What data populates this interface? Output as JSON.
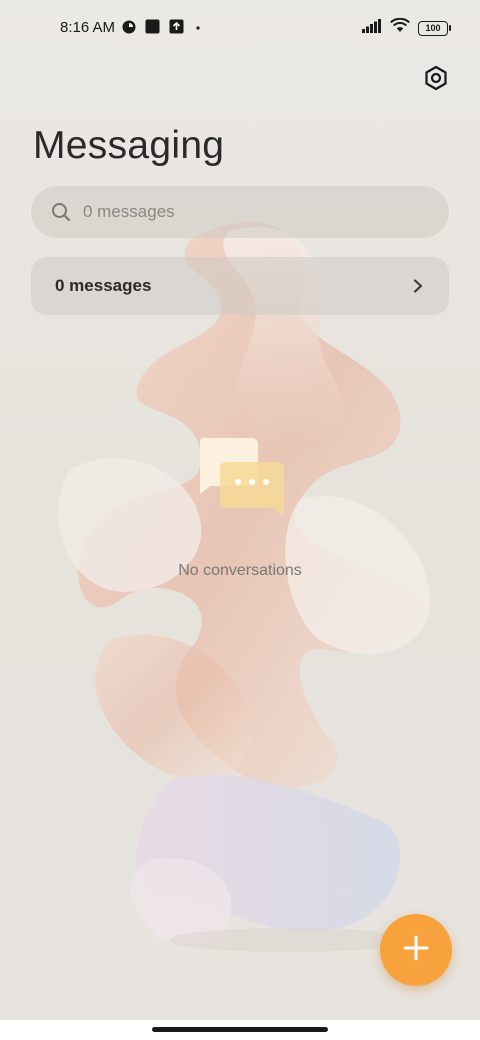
{
  "status_bar": {
    "time": "8:16 AM",
    "battery": "100",
    "icons": [
      "app-status-icon",
      "square-notification-icon",
      "upload-notification-icon",
      "dot-icon",
      "signal-icon",
      "wifi-icon",
      "battery-icon"
    ]
  },
  "header": {
    "title": "Messaging",
    "settings_icon": "settings-icon"
  },
  "search": {
    "placeholder": "0 messages"
  },
  "messages_row": {
    "label": "0 messages"
  },
  "empty_state": {
    "text": "No conversations"
  },
  "fab": {
    "icon": "plus-icon"
  },
  "colors": {
    "accent": "#f7a23c",
    "background": "#e9e6e1"
  }
}
